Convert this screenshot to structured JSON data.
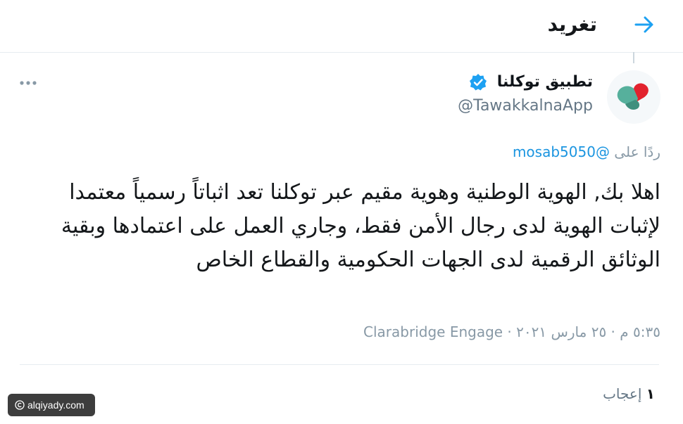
{
  "colors": {
    "accent": "#1da1f2",
    "verified": "#1da1f2",
    "logo_red": "#e2232e",
    "logo_green": "#56b09c"
  },
  "header": {
    "title": "تغريد",
    "back_icon": "arrow-right-icon"
  },
  "tweet": {
    "author_name": "تطبيق توكلنا",
    "author_handle": "@TawakkalnaApp",
    "verified_icon": "verified-badge-icon",
    "more_icon": "more-horizontal-icon",
    "reply_prefix": "ردًا على",
    "reply_handle": "@mosab5050",
    "text": "اهلا بك, الهوية الوطنية وهوية مقيم عبر توكلنا تعد اثباتاً رسمياً معتمدا لإثبات الهوية لدى رجال الأمن فقط، وجاري العمل على اعتمادها وبقية الوثائق الرقمية لدى الجهات الحكومية والقطاع الخاص",
    "time": "٥:٣٥ م",
    "date": "٢٥ مارس ٢٠٢١",
    "source": "Clarabridge Engage"
  },
  "stats": {
    "likes_count": "١",
    "likes_label": "إعجاب"
  },
  "watermark": {
    "text": "alqiyady.com"
  }
}
